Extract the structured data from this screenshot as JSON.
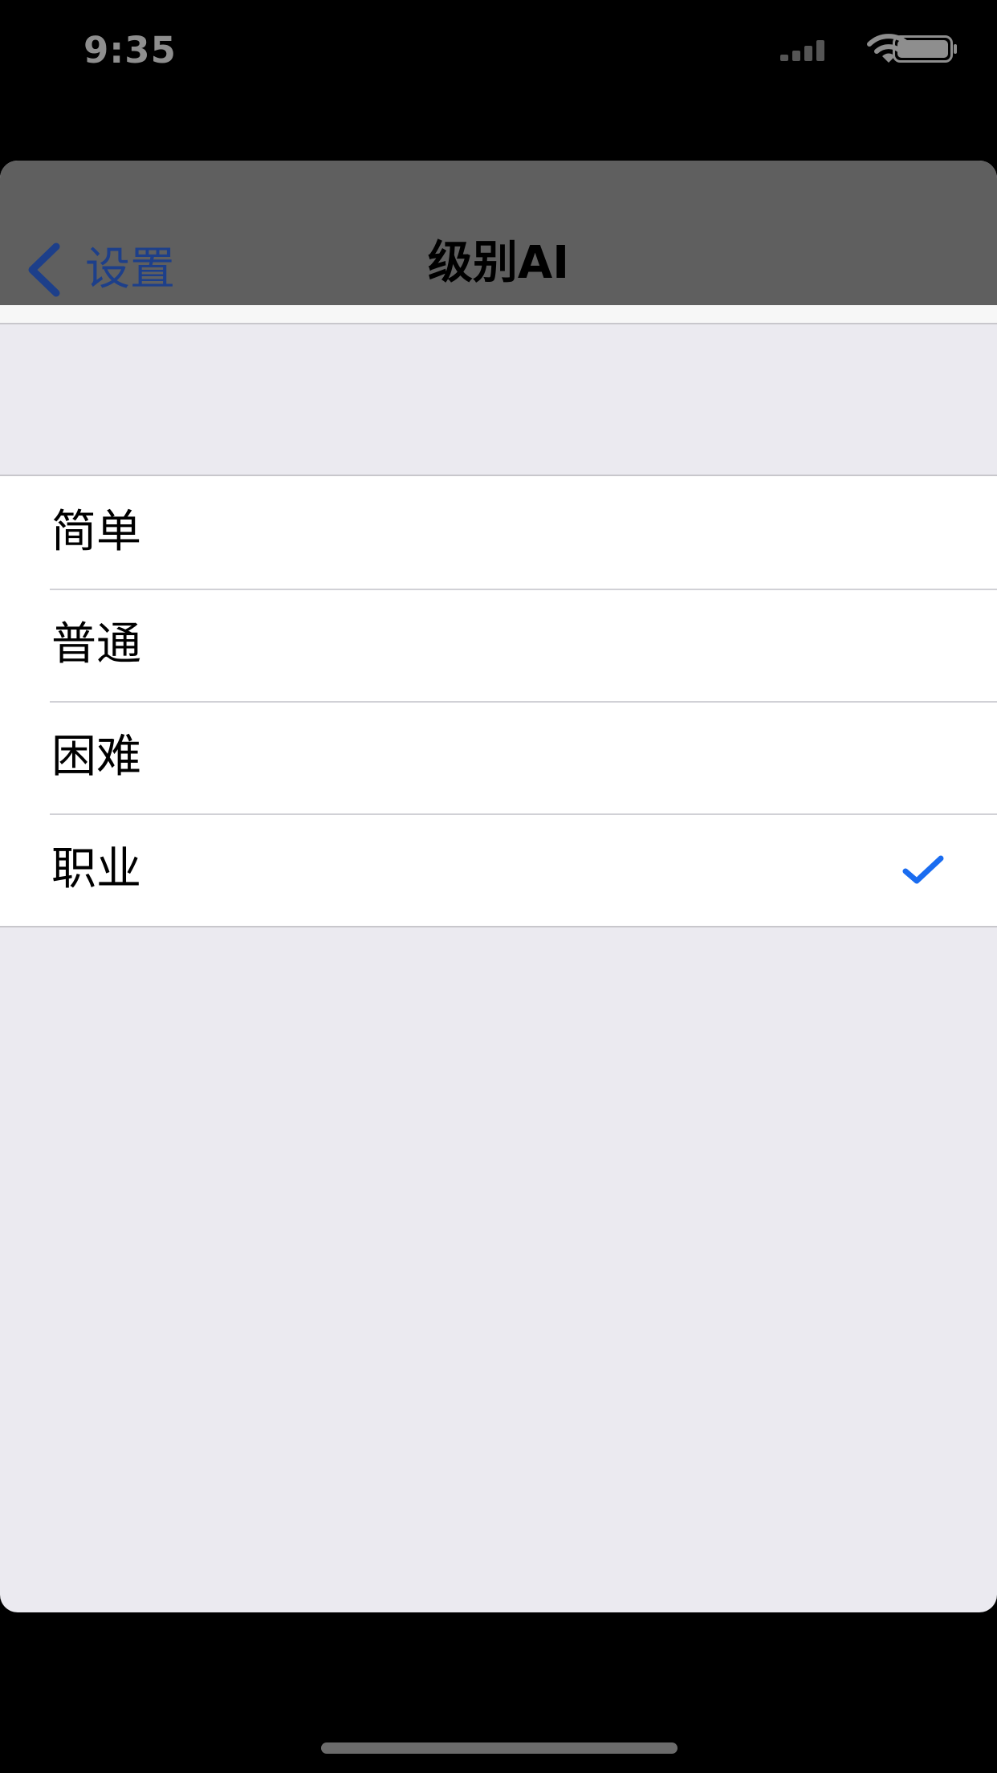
{
  "status_bar": {
    "time": "9:35",
    "icons": [
      "signal-icon",
      "wifi-icon",
      "battery-icon"
    ]
  },
  "nav": {
    "back_label": "设置",
    "title": "级别AI"
  },
  "options": [
    {
      "label": "简单",
      "selected": false
    },
    {
      "label": "普通",
      "selected": false
    },
    {
      "label": "困难",
      "selected": false
    },
    {
      "label": "职业",
      "selected": true
    }
  ],
  "colors": {
    "accent": "#1a6cf0",
    "back_tint": "#1d3f8a",
    "group_background": "#ebeaf0",
    "nav_background": "#5f5f5f"
  }
}
